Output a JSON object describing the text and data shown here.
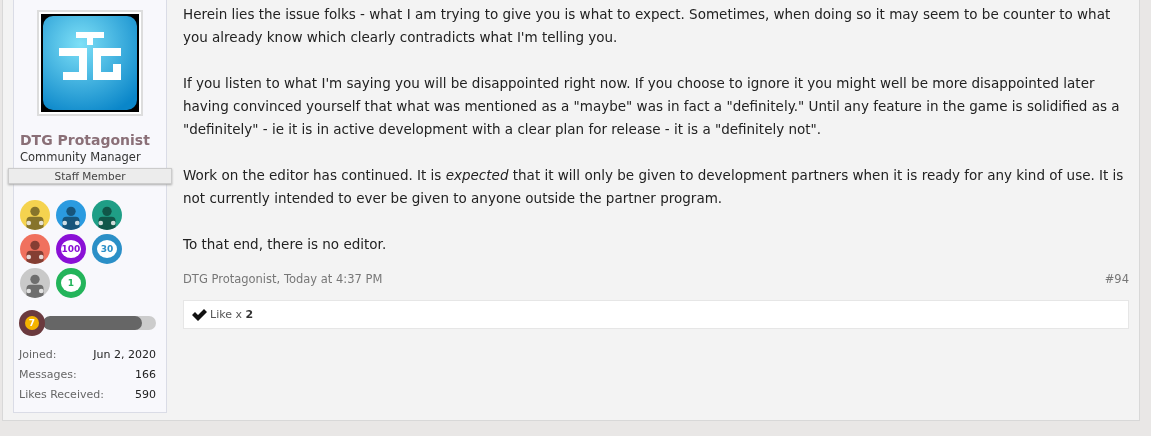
{
  "user": {
    "name": "DTG Protagonist",
    "title": "Community Manager",
    "banner": "Staff Member",
    "badges": [
      {
        "kind": "person",
        "color": "#f5d34f"
      },
      {
        "kind": "person",
        "color": "#2b9be0"
      },
      {
        "kind": "person",
        "color": "#1f9e86"
      },
      {
        "kind": "person",
        "color": "#f0715e"
      },
      {
        "kind": "count",
        "color": "#8a10d6",
        "text": "100"
      },
      {
        "kind": "count",
        "color": "#2b8fc7",
        "text": "30"
      },
      {
        "kind": "person",
        "color": "#c9c9c9"
      },
      {
        "kind": "count",
        "color": "#23b45a",
        "text": "1"
      }
    ],
    "level": {
      "text": "7",
      "level": 0.88
    },
    "stats": [
      {
        "label": "Joined:",
        "value": "Jun 2, 2020"
      },
      {
        "label": "Messages:",
        "value": "166"
      },
      {
        "label": "Likes Received:",
        "value": "590"
      }
    ]
  },
  "message": {
    "paragraphs": [
      "Herein lies the issue folks - what I am trying to give you is what to expect. Sometimes, when doing so it may seem to be counter to what you already know which clearly contradicts what I'm telling you.",
      "If you listen to what I'm saying you will be disappointed right now. If you choose to ignore it you might well be more disappointed later having convinced yourself that what was mentioned as a \"maybe\" was in fact a \"definitely.\" Until any feature in the game is solidified as a \"definitely\" - ie it is in active development with a clear plan for release - it is a \"definitely not\".",
      "Work on the editor has continued. It is *expected* that it will only be given to development partners when it is ready for any kind of use. It is not currently intended to ever be given to anyone outside the partner program.",
      "To that end, there is no editor."
    ],
    "meta": "DTG Protagonist, Today at 4:37 PM",
    "number": "#94",
    "likes": {
      "label": "Like x ",
      "count": "2"
    }
  }
}
